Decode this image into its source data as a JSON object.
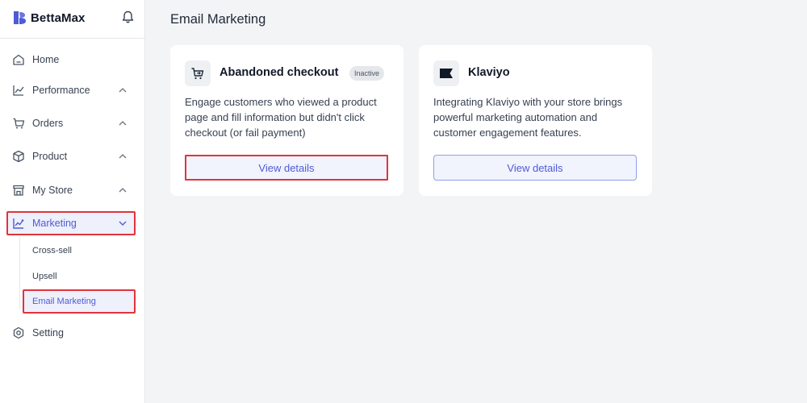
{
  "app": {
    "brand": "BettaMax"
  },
  "sidebar": {
    "items": [
      {
        "label": "Home",
        "icon": "home-icon"
      },
      {
        "label": "Performance",
        "icon": "chart-icon"
      },
      {
        "label": "Orders",
        "icon": "cart-icon"
      },
      {
        "label": "Product",
        "icon": "box-icon"
      },
      {
        "label": "My Store",
        "icon": "store-icon"
      },
      {
        "label": "Marketing",
        "icon": "marketing-icon"
      },
      {
        "label": "Setting",
        "icon": "settings-icon"
      }
    ],
    "marketing_sub": [
      {
        "label": "Cross-sell"
      },
      {
        "label": "Upsell"
      },
      {
        "label": "Email Marketing"
      }
    ]
  },
  "main": {
    "title": "Email Marketing",
    "cards": [
      {
        "title": "Abandoned checkout",
        "badge": "Inactive",
        "description": "Engage customers who viewed a product page and fill information but didn't click checkout (or fail payment)",
        "button": "View details"
      },
      {
        "title": "Klaviyo",
        "description": "Integrating Klaviyo with your store brings powerful marketing automation and customer engagement features.",
        "button": "View details"
      }
    ]
  },
  "colors": {
    "accent": "#4f5bd5",
    "highlight": "#e0343c",
    "background": "#f3f4f6"
  }
}
